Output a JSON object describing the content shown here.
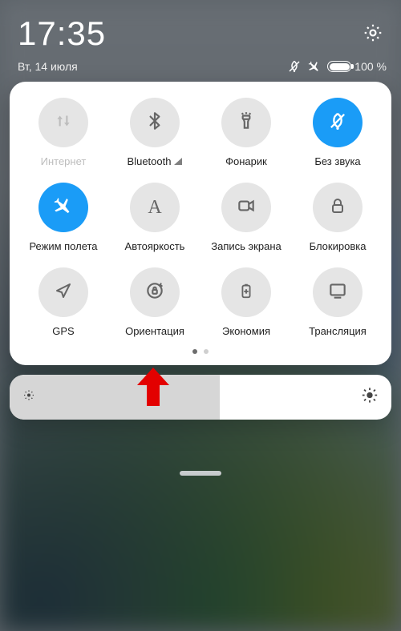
{
  "clock": "17:35",
  "date": "Вт, 14 июля",
  "battery_pct": "100 %",
  "tiles": [
    {
      "label": "Интернет"
    },
    {
      "label": "Bluetooth"
    },
    {
      "label": "Фонарик"
    },
    {
      "label": "Без звука"
    },
    {
      "label": "Режим полета"
    },
    {
      "label": "Автояркость"
    },
    {
      "label": "Запись экрана"
    },
    {
      "label": "Блокировка"
    },
    {
      "label": "GPS"
    },
    {
      "label": "Ориентация"
    },
    {
      "label": "Экономия"
    },
    {
      "label": "Трансляция"
    }
  ],
  "brightness": {
    "value_pct": 55
  }
}
